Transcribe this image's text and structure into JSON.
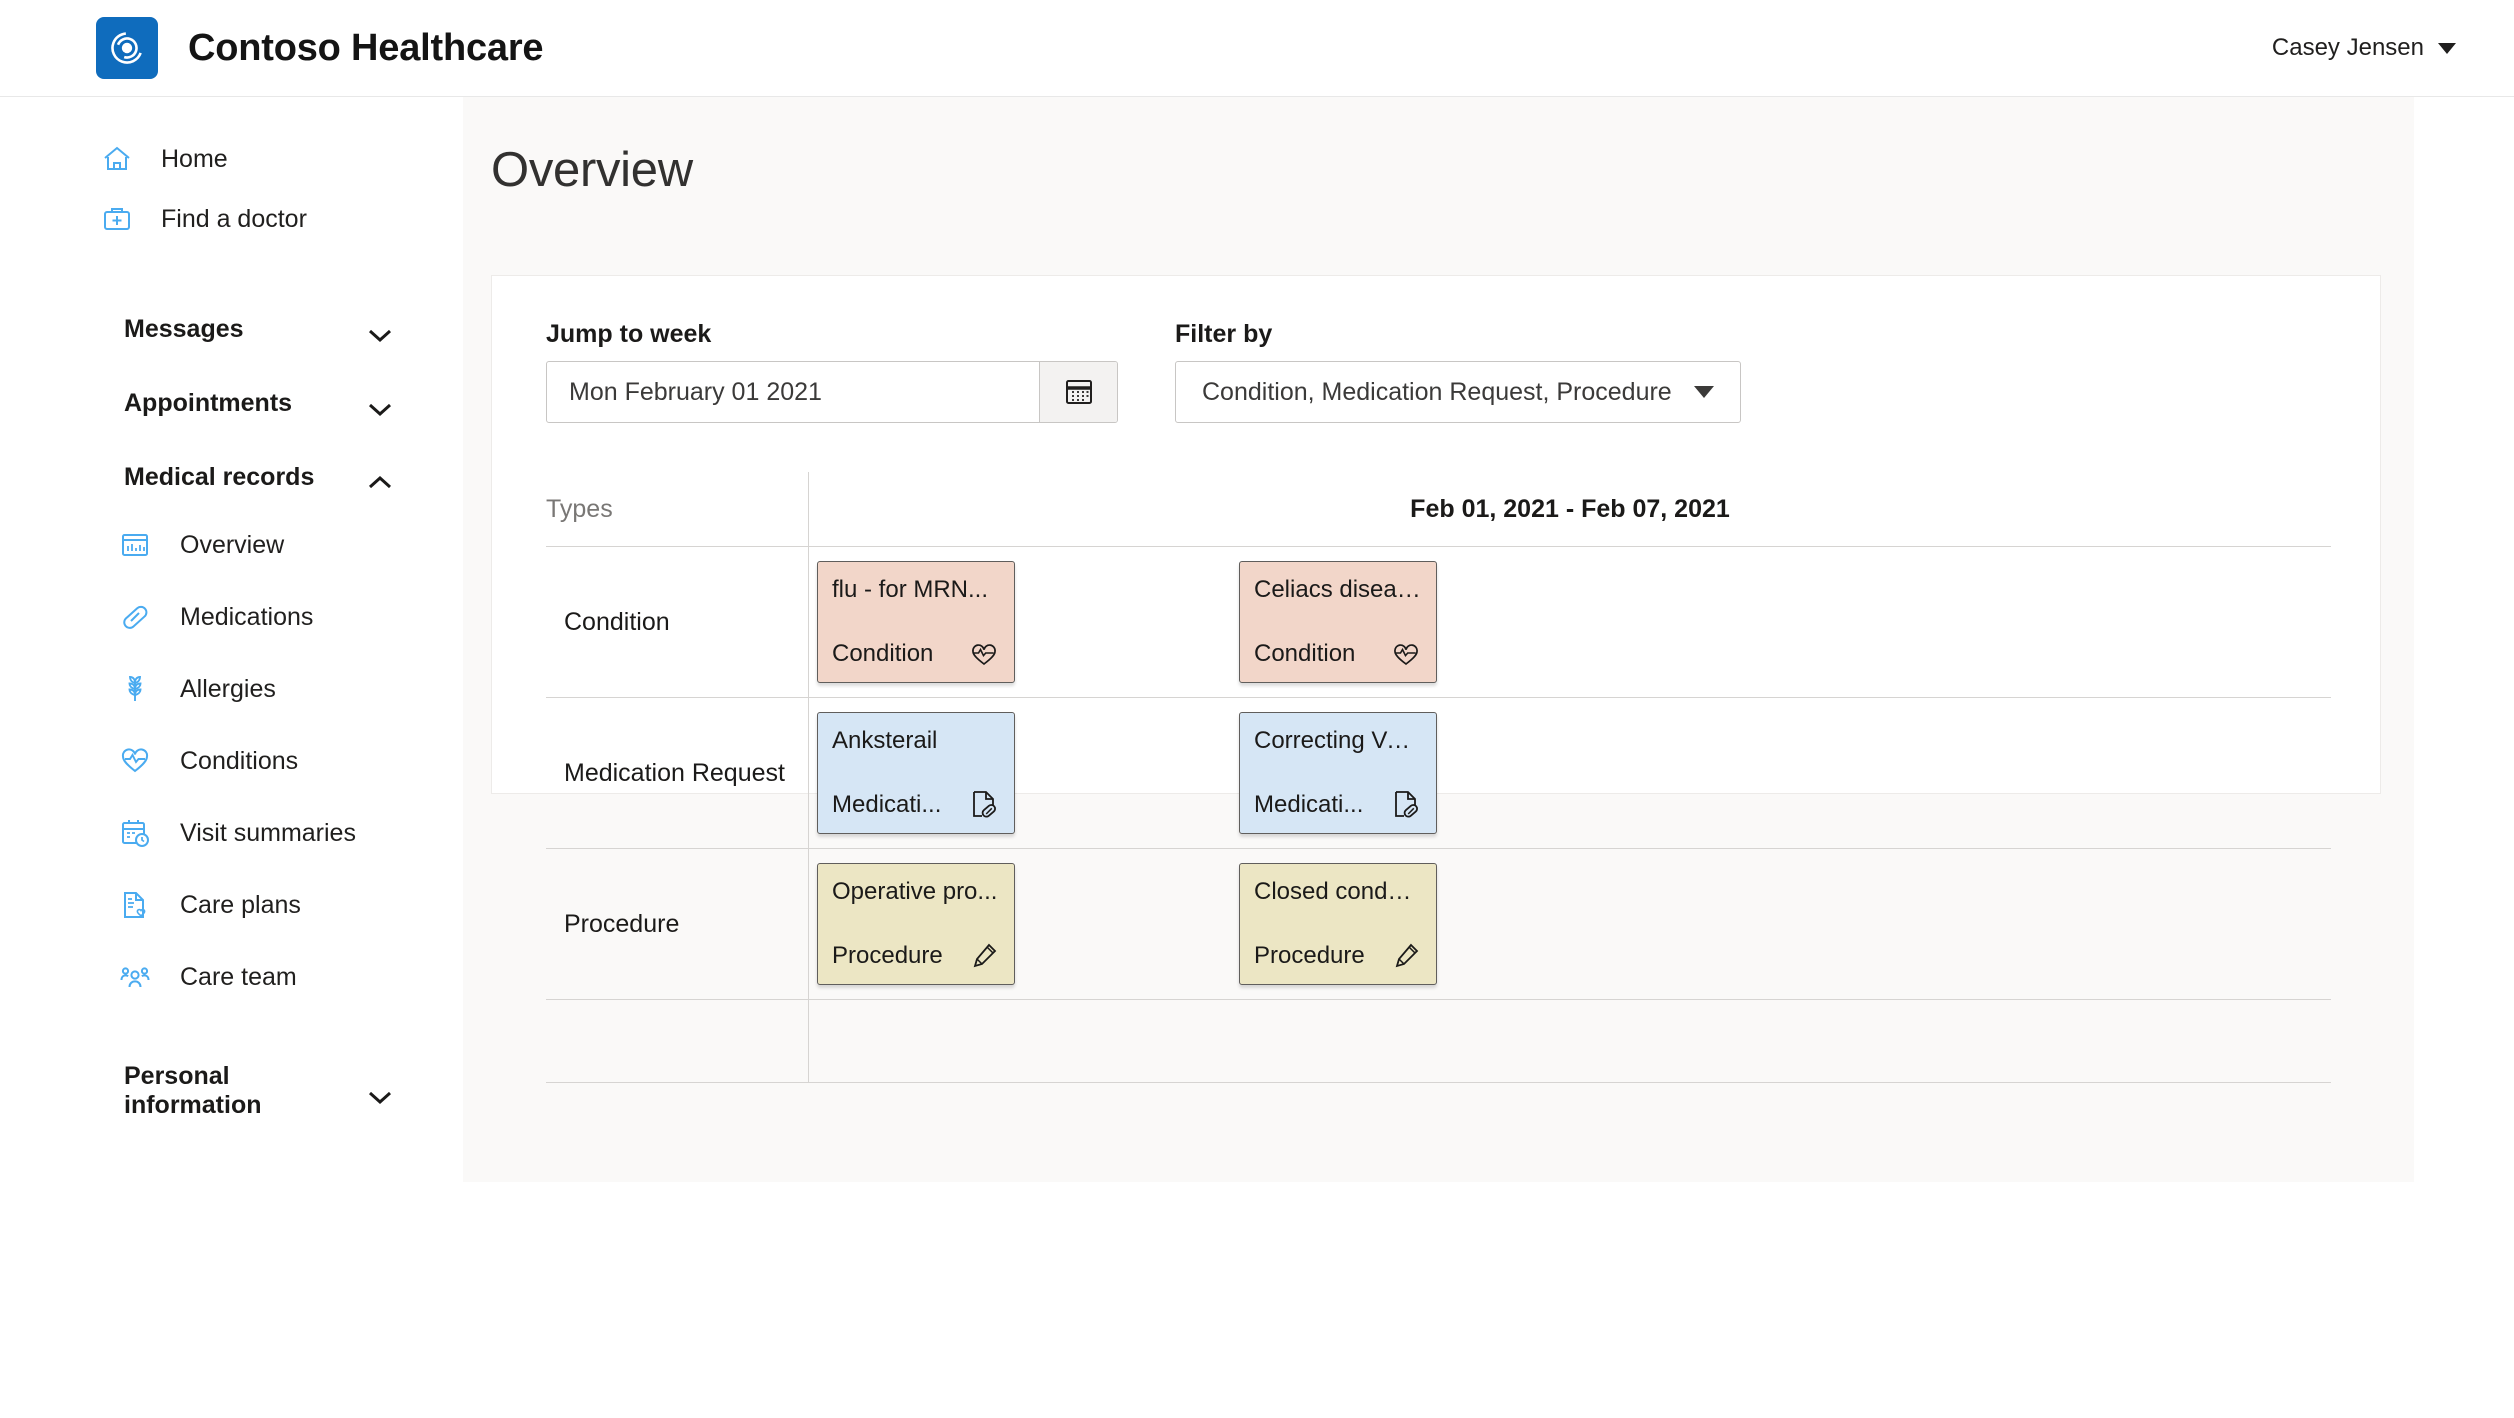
{
  "header": {
    "brand_title": "Contoso Healthcare",
    "logo_icon": "contoso-swirl-logo",
    "account_name": "Casey Jensen",
    "account_caret_icon": "chevron-down-icon",
    "logo_color": "#0f6cbd"
  },
  "sidebar": {
    "top_links": [
      {
        "label": "Home",
        "icon": "home-icon"
      },
      {
        "label": "Find a doctor",
        "icon": "doctor-bag-icon"
      }
    ],
    "groups": [
      {
        "label": "Messages",
        "chevron_icon": "chevron-down-icon",
        "expanded": false
      },
      {
        "label": "Appointments",
        "chevron_icon": "chevron-down-icon",
        "expanded": false
      },
      {
        "label": "Medical records",
        "chevron_icon": "chevron-up-icon",
        "expanded": true
      }
    ],
    "medical_records_items": [
      {
        "label": "Overview",
        "icon": "chart-report-icon"
      },
      {
        "label": "Medications",
        "icon": "pill-capsule-icon"
      },
      {
        "label": "Allergies",
        "icon": "wheat-grain-icon"
      },
      {
        "label": "Conditions",
        "icon": "heart-pulse-icon"
      },
      {
        "label": "Visit summaries",
        "icon": "calendar-clock-icon"
      },
      {
        "label": "Care plans",
        "icon": "document-heart-icon"
      },
      {
        "label": "Care team",
        "icon": "people-group-icon"
      }
    ],
    "personal_group": {
      "label": "Personal information",
      "chevron_icon": "chevron-down-icon",
      "expanded": false
    },
    "icon_color": "#4aabf0"
  },
  "main": {
    "page_title": "Overview",
    "jump_to_week": {
      "label": "Jump to week",
      "value": "Mon February 01 2021",
      "placeholder": "Mon February 01 2021",
      "calendar_icon": "calendar-icon"
    },
    "filter_by": {
      "label": "Filter by",
      "value": "Condition, Medication Request, Procedure",
      "caret_icon": "chevron-down-icon",
      "options": [
        "Condition",
        "Medication Request",
        "Procedure"
      ]
    },
    "timeline": {
      "types_header": "Types",
      "date_range": "Feb 01, 2021 - Feb 07, 2021",
      "rows": [
        {
          "label": "Condition",
          "bg": "#f2d6c9",
          "border": "#605e5c",
          "icon": "heart-pulse-icon",
          "cards": [
            {
              "title": "flu - for MRN...",
              "type": "Condition"
            },
            {
              "title": "Celiacs diseas...",
              "type": "Condition"
            }
          ]
        },
        {
          "label": "Medication Request",
          "bg": "#d6e6f5",
          "border": "#605e5c",
          "icon": "document-pill-icon",
          "cards": [
            {
              "title": "Anksterail",
              "type": "Medicati..."
            },
            {
              "title": "Correcting Vei...",
              "type": "Medicati..."
            }
          ]
        },
        {
          "label": "Procedure",
          "bg": "#ece6c4",
          "border": "#605e5c",
          "icon": "syringe-icon",
          "cards": [
            {
              "title": "Operative pro...",
              "type": "Procedure"
            },
            {
              "title": "Closed condyl...",
              "type": "Procedure"
            }
          ]
        }
      ]
    }
  }
}
